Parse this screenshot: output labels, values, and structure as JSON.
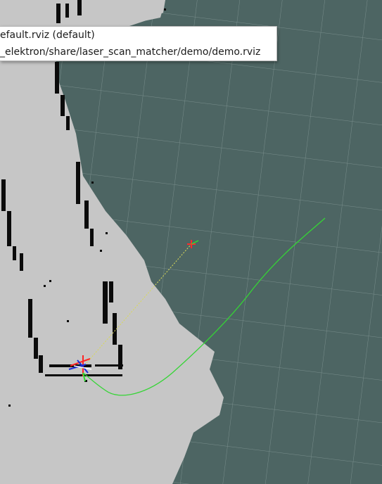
{
  "recent_configs_menu": {
    "items": [
      {
        "label": "efault.rviz (default)"
      },
      {
        "label": "_elektron/share/laser_scan_matcher/demo/demo.rviz"
      }
    ]
  },
  "colors": {
    "background": "#4d6563",
    "grid_line": "#788d8b",
    "free_space": "#c6c6c6",
    "obstacle": "#0b0b0b",
    "path": "#35d535"
  }
}
